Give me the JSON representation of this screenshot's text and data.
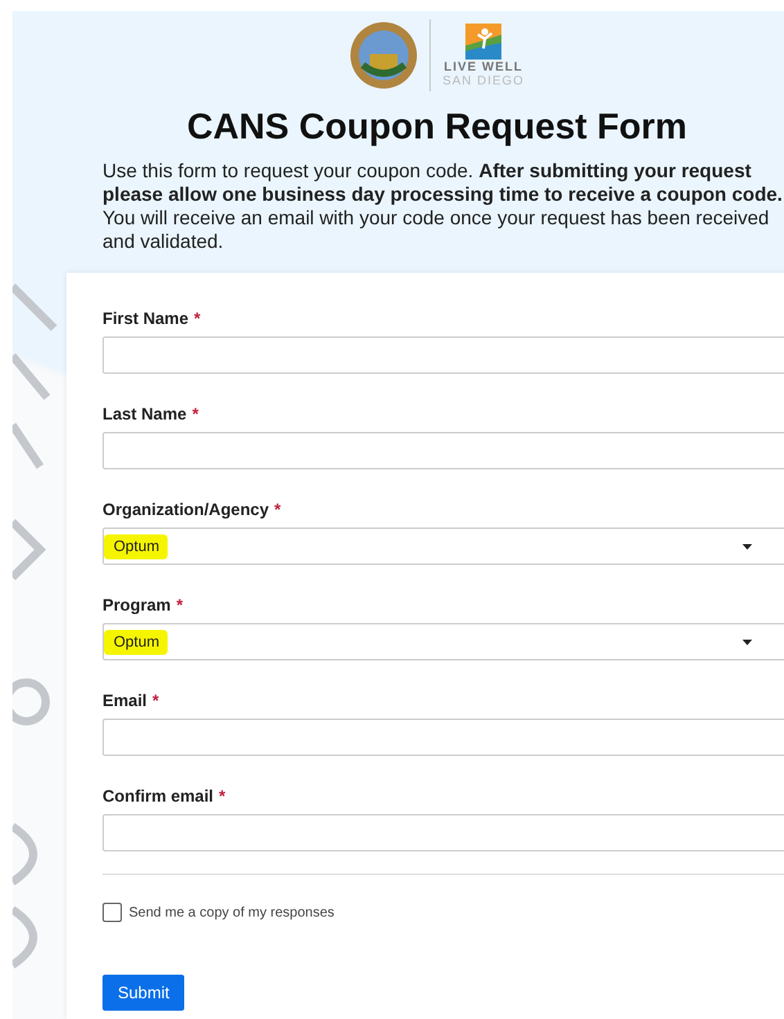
{
  "header": {
    "logo_text": "LIVE WELL",
    "logo_subtext": "SAN DIEGO",
    "title": "CANS Coupon Request Form",
    "description": "Use this form to request your coupon code. **After submitting your request please allow one business day processing time to receive a coupon code.** You will receive an email with your code once your request has been received and validated."
  },
  "fields": [
    {
      "kind": "text",
      "label": "First Name",
      "required_mark": "*"
    },
    {
      "kind": "text",
      "label": "Last Name",
      "required_mark": "*"
    },
    {
      "kind": "select",
      "label": "Organization/Agency",
      "required_mark": "*",
      "value": "Optum",
      "highlighted": true
    },
    {
      "kind": "select",
      "label": "Program",
      "required_mark": "*",
      "value": "Optum",
      "highlighted": true
    },
    {
      "kind": "text",
      "label": "Email",
      "required_mark": "*"
    },
    {
      "kind": "text",
      "label": "Confirm email",
      "required_mark": "*"
    }
  ],
  "copy_checkbox": {
    "label": "Send me a copy of my responses",
    "checked": false
  },
  "submit": "Submit"
}
